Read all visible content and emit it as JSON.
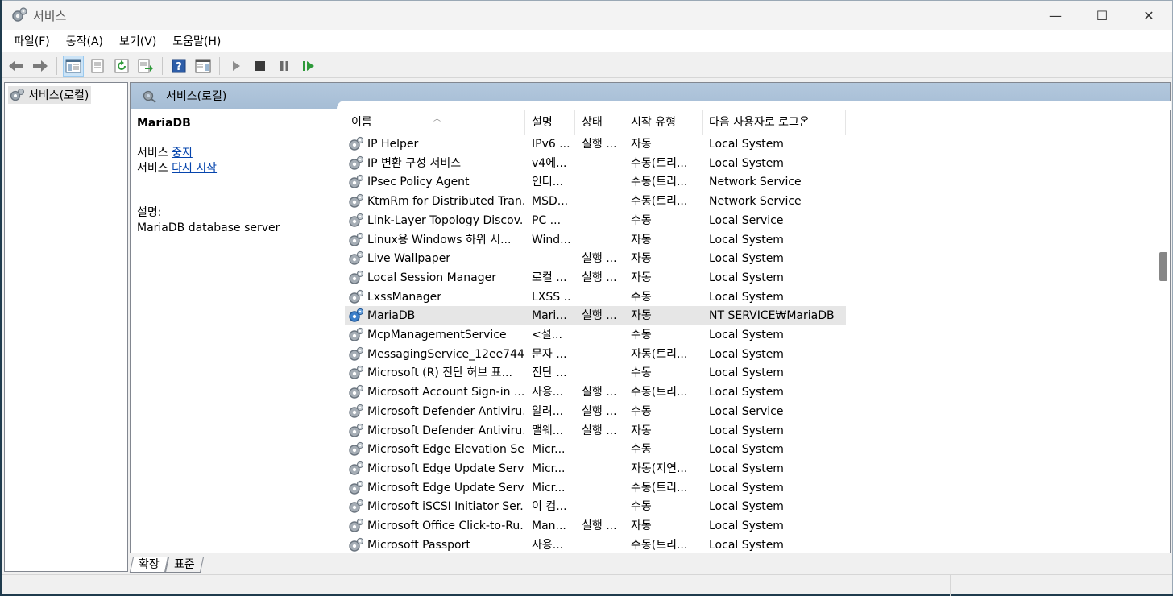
{
  "window": {
    "title": "서비스",
    "minimize": "—",
    "maximize": "☐",
    "close": "✕"
  },
  "menu": [
    "파일(F)",
    "동작(A)",
    "보기(V)",
    "도움말(H)"
  ],
  "tree": {
    "root": "서비스(로컬)"
  },
  "pane": {
    "header": "서비스(로컬)"
  },
  "details": {
    "service_name": "MariaDB",
    "stop_prefix": "서비스 ",
    "stop_link": "중지",
    "restart_prefix": "서비스 ",
    "restart_link": "다시 시작",
    "desc_label": "설명:",
    "desc_text": "MariaDB database server"
  },
  "columns": {
    "name": "이름",
    "description": "설명",
    "status": "상태",
    "startup": "시작 유형",
    "logon": "다음 사용자로 로그온"
  },
  "services": [
    {
      "name": "IP Helper",
      "description": "IPv6 ...",
      "status": "실행 ...",
      "startup": "자동",
      "logon": "Local System"
    },
    {
      "name": "IP 변환 구성 서비스",
      "description": "v4에...",
      "status": "",
      "startup": "수동(트리...",
      "logon": "Local System"
    },
    {
      "name": "IPsec Policy Agent",
      "description": "인터...",
      "status": "",
      "startup": "수동(트리...",
      "logon": "Network Service"
    },
    {
      "name": "KtmRm for Distributed Tran...",
      "description": "MSD...",
      "status": "",
      "startup": "수동(트리...",
      "logon": "Network Service"
    },
    {
      "name": "Link-Layer Topology Discov...",
      "description": "PC ...",
      "status": "",
      "startup": "수동",
      "logon": "Local Service"
    },
    {
      "name": "Linux용 Windows 하위 시...",
      "description": "Wind...",
      "status": "",
      "startup": "자동",
      "logon": "Local System"
    },
    {
      "name": "Live Wallpaper",
      "description": "",
      "status": "실행 ...",
      "startup": "자동",
      "logon": "Local System"
    },
    {
      "name": "Local Session Manager",
      "description": "로컬 ...",
      "status": "실행 ...",
      "startup": "자동",
      "logon": "Local System"
    },
    {
      "name": "LxssManager",
      "description": "LXSS ...",
      "status": "",
      "startup": "수동",
      "logon": "Local System"
    },
    {
      "name": "MariaDB",
      "description": "Mari...",
      "status": "실행 ...",
      "startup": "자동",
      "logon": "NT SERVICE₩MariaDB",
      "selected": true
    },
    {
      "name": "McpManagementService",
      "description": "<설...",
      "status": "",
      "startup": "수동",
      "logon": "Local System"
    },
    {
      "name": "MessagingService_12ee744a",
      "description": "문자 ...",
      "status": "",
      "startup": "자동(트리...",
      "logon": "Local System"
    },
    {
      "name": "Microsoft (R) 진단 허브 표...",
      "description": "진단 ...",
      "status": "",
      "startup": "수동",
      "logon": "Local System"
    },
    {
      "name": "Microsoft Account Sign-in ...",
      "description": "사용...",
      "status": "실행 ...",
      "startup": "수동(트리...",
      "logon": "Local System"
    },
    {
      "name": "Microsoft Defender Antiviru...",
      "description": "알려...",
      "status": "실행 ...",
      "startup": "수동",
      "logon": "Local Service"
    },
    {
      "name": "Microsoft Defender Antiviru...",
      "description": "맬웨...",
      "status": "실행 ...",
      "startup": "자동",
      "logon": "Local System"
    },
    {
      "name": "Microsoft Edge Elevation Se...",
      "description": "Micr...",
      "status": "",
      "startup": "수동",
      "logon": "Local System"
    },
    {
      "name": "Microsoft Edge Update Serv...",
      "description": "Micr...",
      "status": "",
      "startup": "자동(지연...",
      "logon": "Local System"
    },
    {
      "name": "Microsoft Edge Update Serv...",
      "description": "Micr...",
      "status": "",
      "startup": "수동(트리...",
      "logon": "Local System"
    },
    {
      "name": "Microsoft iSCSI Initiator Ser...",
      "description": "이 컴...",
      "status": "",
      "startup": "수동",
      "logon": "Local System"
    },
    {
      "name": "Microsoft Office Click-to-Ru...",
      "description": "Man...",
      "status": "실행 ...",
      "startup": "자동",
      "logon": "Local System"
    },
    {
      "name": "Microsoft Passport",
      "description": "사용...",
      "status": "",
      "startup": "수동(트리...",
      "logon": "Local System"
    }
  ],
  "tabs": [
    "확장",
    "표준"
  ],
  "colors": {
    "selected_row": "#e6e6e6",
    "pane_header": "#a6bdd5",
    "link": "#0645ad"
  }
}
